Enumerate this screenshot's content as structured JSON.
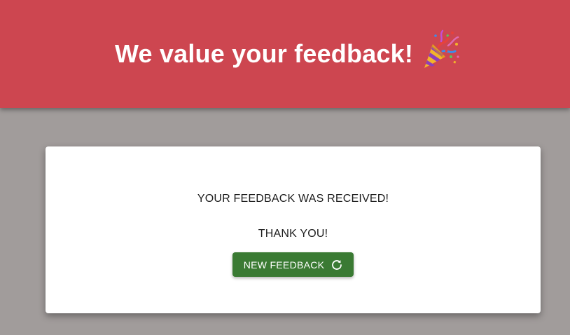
{
  "header": {
    "title": "We value your feedback!",
    "emoji_icon": "party-popper-icon",
    "background_color": "#cd4650"
  },
  "page": {
    "background_color": "#a19c9b"
  },
  "card": {
    "message": "YOUR FEEDBACK WAS RECEIVED!",
    "thanks": "THANK YOU!",
    "new_feedback_button": {
      "label": "NEW FEEDBACK",
      "icon": "refresh-icon",
      "color": "#3a7a33"
    }
  }
}
